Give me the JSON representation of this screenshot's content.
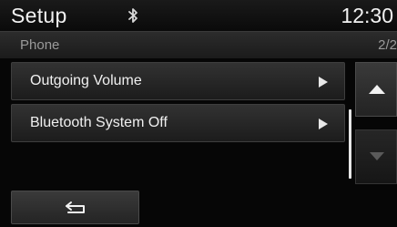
{
  "header": {
    "title": "Setup",
    "bluetooth_icon": "bluetooth-icon",
    "clock": "12:30"
  },
  "subheader": {
    "section": "Phone",
    "page": "2/2"
  },
  "menu": {
    "items": [
      {
        "label": "Outgoing Volume",
        "icon": "play-arrow-icon"
      },
      {
        "label": "Bluetooth System Off",
        "icon": "play-arrow-icon"
      }
    ]
  },
  "scroll": {
    "up_icon": "scroll-up-icon",
    "down_icon": "scroll-down-icon"
  },
  "footer": {
    "back_icon": "back-icon"
  },
  "colors": {
    "background": "#060606",
    "text": "#f0f0f0",
    "muted_text": "#9a9a9a",
    "button": "#2b2b2b"
  }
}
